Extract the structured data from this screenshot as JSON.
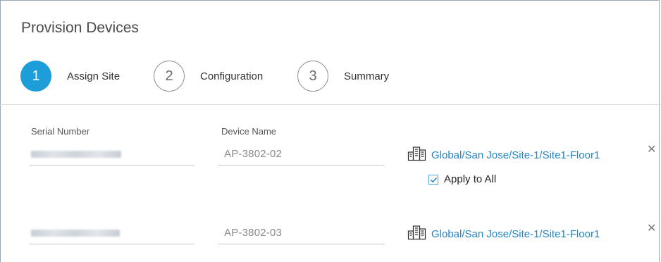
{
  "page": {
    "title": "Provision Devices"
  },
  "steps": [
    {
      "number": "1",
      "label": "Assign Site",
      "active": true
    },
    {
      "number": "2",
      "label": "Configuration",
      "active": false
    },
    {
      "number": "3",
      "label": "Summary",
      "active": false
    }
  ],
  "columns": {
    "serial": "Serial Number",
    "device_name": "Device Name"
  },
  "devices": [
    {
      "serial": "",
      "device_name": "AP-3802-02",
      "site_path": "Global/San Jose/Site-1/Site1-Floor1",
      "apply_to_all_label": "Apply to All",
      "apply_to_all_checked": true
    },
    {
      "serial": "",
      "device_name": "AP-3802-03",
      "site_path": "Global/San Jose/Site-1/Site1-Floor1"
    }
  ],
  "icons": {
    "site": "building-icon",
    "remove": "close-icon",
    "check": "checkmark-icon"
  },
  "colors": {
    "accent": "#1e9ed9",
    "link": "#1e86c9"
  }
}
